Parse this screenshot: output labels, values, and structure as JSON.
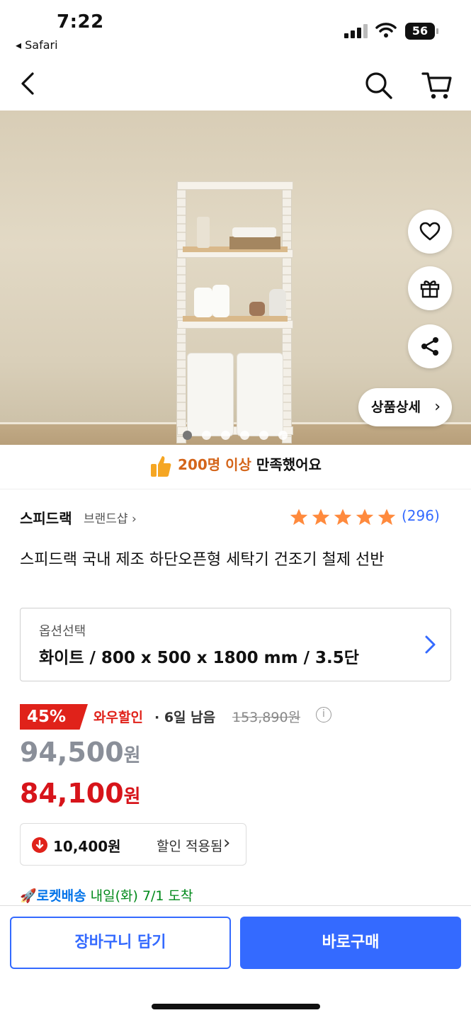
{
  "status_bar": {
    "time": "7:22",
    "back_app": "◂ Safari",
    "battery": "56"
  },
  "nav": {
    "back_icon": "chevron-left-icon",
    "search_icon": "search-icon",
    "cart_icon": "cart-icon"
  },
  "hero": {
    "detail_button": "상품상세",
    "fab_icons": [
      "heart-icon",
      "gift-icon",
      "share-icon"
    ],
    "carousel": {
      "total": 6,
      "active_index": 0
    }
  },
  "satisfaction": {
    "highlight": "200명 이상",
    "text": " 만족했어요"
  },
  "product": {
    "brand": "스피드랙",
    "brand_shop": "브랜드샵",
    "rating": 5,
    "review_count": "(296)",
    "title": "스피드랙 국내 제조 하단오픈형 세탁기 건조기 철제 선반"
  },
  "option": {
    "label": "옵션선택",
    "value": "화이트 / 800 x 500 x 1800 mm / 3.5단"
  },
  "price": {
    "discount_pct": "45%",
    "wow": "와우할인",
    "remaining": "· 6일 남음",
    "original": "153,890원",
    "sale": "94,500",
    "final": "84,100",
    "won": "원",
    "coupon_amount": "10,400원",
    "coupon_text": "할인 적용됨"
  },
  "delivery": {
    "name": "로켓배송",
    "date": " 내일(화) 7/1 도착"
  },
  "actions": {
    "add_to_cart": "장바구니 담기",
    "buy_now": "바로구매"
  },
  "colors": {
    "accent": "#346aff",
    "sale_red": "#e0221a",
    "price_red": "#d7141a",
    "rocket_blue": "#0073e9",
    "star": "#ff8a3d"
  }
}
